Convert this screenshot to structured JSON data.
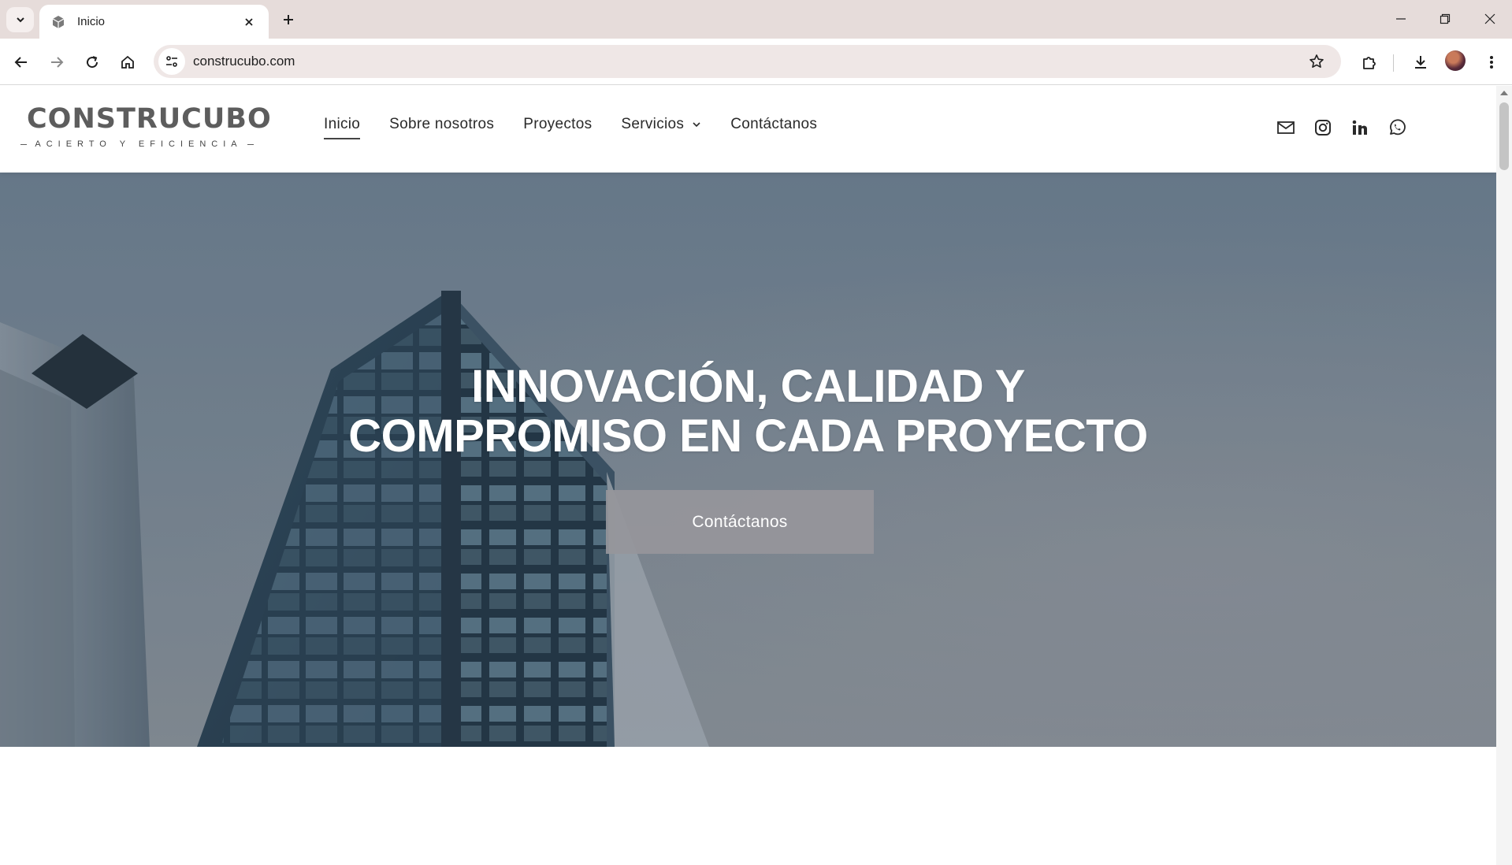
{
  "browser": {
    "tab_title": "Inicio",
    "url": "construcubo.com"
  },
  "site": {
    "logo_text": "CONSTRUCUBO",
    "logo_tagline": "ACIERTO Y EFICIENCIA",
    "nav": [
      {
        "label": "Inicio"
      },
      {
        "label": "Sobre nosotros"
      },
      {
        "label": "Proyectos"
      },
      {
        "label": "Servicios"
      },
      {
        "label": "Contáctanos"
      }
    ],
    "socials": [
      "mail-icon",
      "instagram-icon",
      "linkedin-icon",
      "whatsapp-icon"
    ]
  },
  "hero": {
    "title_line1": "INNOVACIÓN, CALIDAD Y",
    "title_line2": "COMPROMISO EN CADA PROYECTO",
    "cta_label": "Contáctanos"
  },
  "colors": {
    "tabstrip": "#e6dcda",
    "hero_button": "#96969b",
    "logo": "#5d5d5d"
  }
}
